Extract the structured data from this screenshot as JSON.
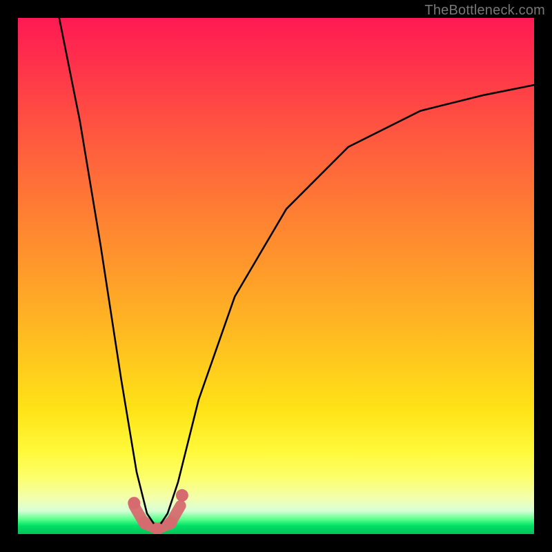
{
  "watermark": "TheBottleneck.com",
  "chart_data": {
    "type": "line",
    "title": "",
    "xlabel": "",
    "ylabel": "",
    "xlim": [
      0,
      1
    ],
    "ylim": [
      0,
      1
    ],
    "x_min_at": 0.27,
    "series": [
      {
        "name": "curve",
        "x": [
          0.08,
          0.12,
          0.16,
          0.2,
          0.23,
          0.25,
          0.27,
          0.29,
          0.31,
          0.35,
          0.42,
          0.52,
          0.64,
          0.78,
          0.9,
          1.0
        ],
        "y": [
          1.0,
          0.8,
          0.56,
          0.3,
          0.12,
          0.04,
          0.01,
          0.04,
          0.1,
          0.26,
          0.46,
          0.63,
          0.75,
          0.82,
          0.85,
          0.87
        ]
      }
    ],
    "highlight_band": {
      "x": [
        0.225,
        0.245,
        0.27,
        0.295,
        0.315
      ],
      "y": [
        0.055,
        0.02,
        0.01,
        0.02,
        0.055
      ]
    },
    "highlight_points": [
      {
        "x": 0.225,
        "y": 0.06
      },
      {
        "x": 0.245,
        "y": 0.022
      },
      {
        "x": 0.27,
        "y": 0.01
      },
      {
        "x": 0.296,
        "y": 0.022
      },
      {
        "x": 0.318,
        "y": 0.075
      }
    ],
    "background_gradient": {
      "top": "#ff1a53",
      "mid": "#ffd21a",
      "bottom": "#00c25a"
    }
  }
}
